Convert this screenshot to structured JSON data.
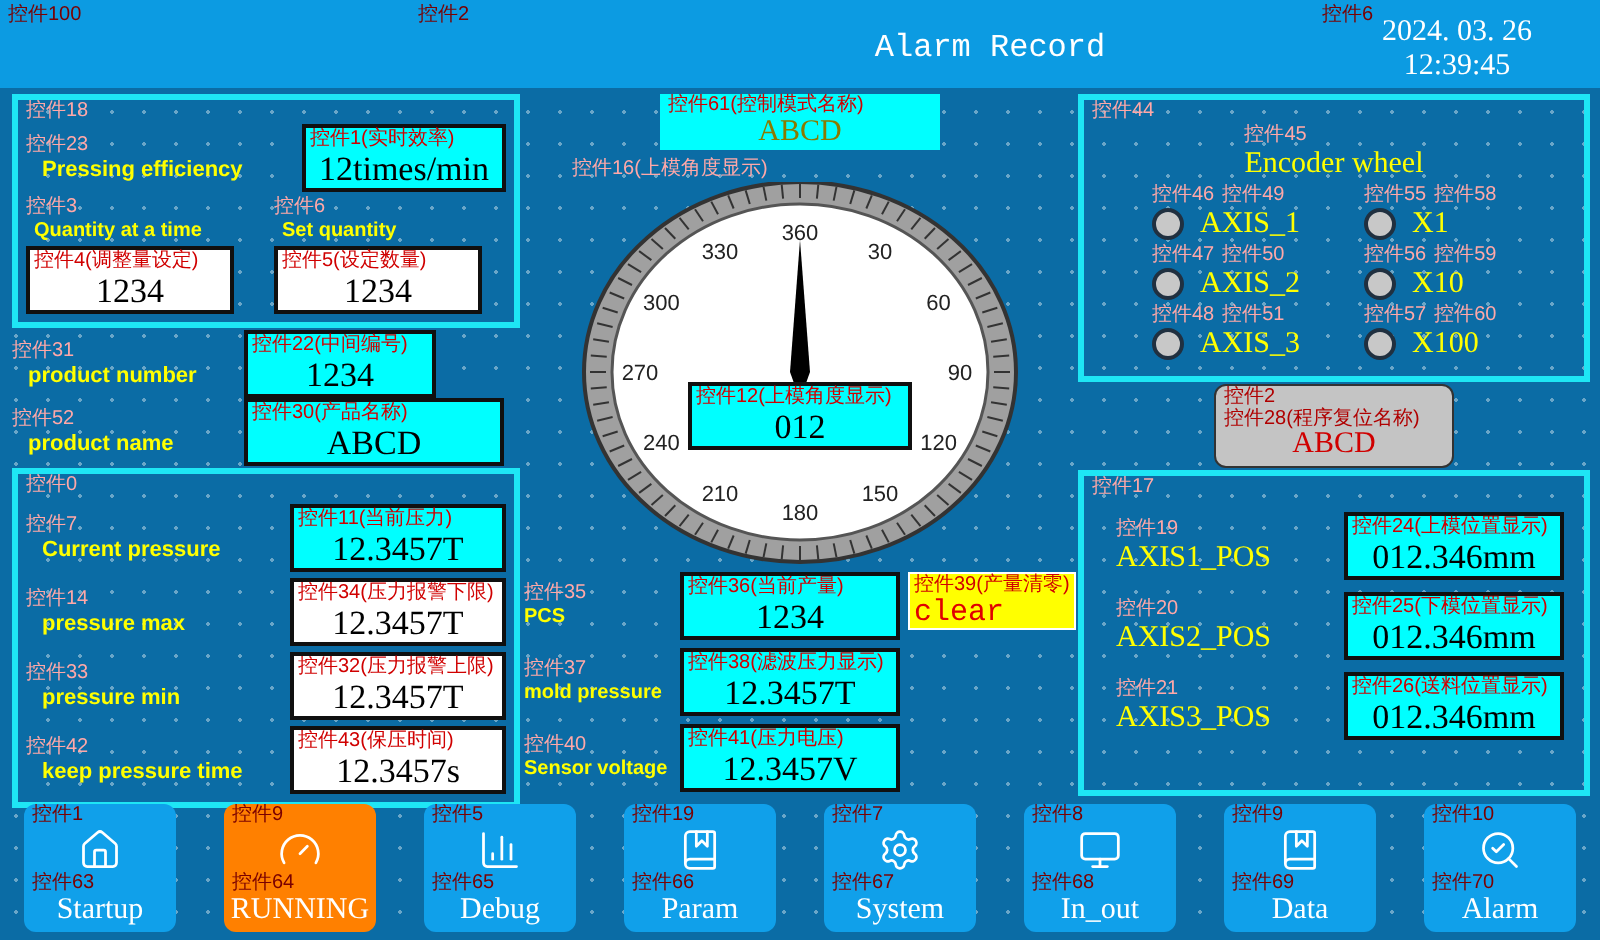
{
  "header": {
    "tag_left": "控件100",
    "tag_center": "控件2",
    "tag_right": "控件6",
    "title": "Alarm Record",
    "date": "2024. 03. 26",
    "time": "12:39:45"
  },
  "production_panel": {
    "tag": "控件18",
    "efficiency": {
      "label_tag": "控件23",
      "label": "Pressing efficiency",
      "field": {
        "tag": "控件1(实时效率)",
        "value": "12times/min",
        "kind": "display"
      }
    },
    "quantities": [
      {
        "label_tag": "控件3",
        "label": "Quantity at a time",
        "field": {
          "tag": "控件4(调整量设定)",
          "value": "1234",
          "kind": "input"
        }
      },
      {
        "label_tag": "控件6",
        "label": "Set quantity",
        "field": {
          "tag": "控件5(设定数量)",
          "value": "1234",
          "kind": "input"
        }
      }
    ]
  },
  "product_fields": [
    {
      "label_tag": "控件31",
      "label": "product number",
      "field": {
        "tag": "控件22(中间编号)",
        "value": "1234",
        "kind": "display"
      }
    },
    {
      "label_tag": "控件52",
      "label": "product name",
      "field": {
        "tag": "控件30(产品名称)",
        "value": "ABCD",
        "kind": "display"
      }
    }
  ],
  "pressure_panel": {
    "tag": "控件0",
    "rows": [
      {
        "label_tag": "控件7",
        "label": "Current pressure",
        "field": {
          "tag": "控件11(当前压力)",
          "value": "12.3457T",
          "kind": "display"
        }
      },
      {
        "label_tag": "控件14",
        "label": "pressure max",
        "field": {
          "tag": "控件34(压力报警下限)",
          "value": "12.3457T",
          "kind": "input"
        }
      },
      {
        "label_tag": "控件33",
        "label": "pressure min",
        "field": {
          "tag": "控件32(压力报警上限)",
          "value": "12.3457T",
          "kind": "input"
        }
      },
      {
        "label_tag": "控件42",
        "label": "keep pressure time",
        "field": {
          "tag": "控件43(保压时间)",
          "value": "12.3457s",
          "kind": "input"
        }
      }
    ]
  },
  "mode_display": {
    "tag": "控件61(控制模式名称)",
    "value": "ABCD"
  },
  "gauge": {
    "tag": "控件16(上模角度显示)",
    "scale": [
      "360",
      "30",
      "60",
      "90",
      "120",
      "150",
      "180",
      "210",
      "240",
      "270",
      "300",
      "330"
    ],
    "field": {
      "tag": "控件12(上模角度显示)",
      "value": "012",
      "kind": "display"
    }
  },
  "counters": [
    {
      "label_tag": "控件35",
      "label": "PCS",
      "field": {
        "tag": "控件36(当前产量)",
        "value": "1234",
        "kind": "display"
      },
      "action": {
        "tag": "控件39(产量清零)",
        "label": "clear"
      }
    },
    {
      "label_tag": "控件37",
      "label": "mold pressure",
      "field": {
        "tag": "控件38(滤波压力显示)",
        "value": "12.3457T",
        "kind": "display"
      }
    },
    {
      "label_tag": "控件40",
      "label": "Sensor voltage",
      "field": {
        "tag": "控件41(压力电压)",
        "value": "12.3457V",
        "kind": "display"
      }
    }
  ],
  "encoder_panel": {
    "tag": "控件44",
    "title_tag": "控件45",
    "title": "Encoder wheel",
    "options": [
      {
        "lamp_tag": "控件46",
        "label_tag": "控件49",
        "label": "AXIS_1",
        "on": false
      },
      {
        "lamp_tag": "控件55",
        "label_tag": "控件58",
        "label": "X1",
        "on": false
      },
      {
        "lamp_tag": "控件47",
        "label_tag": "控件50",
        "label": "AXIS_2",
        "on": false
      },
      {
        "lamp_tag": "控件56",
        "label_tag": "控件59",
        "label": "X10",
        "on": false
      },
      {
        "lamp_tag": "控件48",
        "label_tag": "控件51",
        "label": "AXIS_3",
        "on": false
      },
      {
        "lamp_tag": "控件57",
        "label_tag": "控件60",
        "label": "X100",
        "on": false
      }
    ]
  },
  "reset_button": {
    "tag": "控件2",
    "label_tag": "控件28(程序复位名称)",
    "label": "ABCD"
  },
  "position_panel": {
    "tag": "控件17",
    "rows": [
      {
        "label_tag": "控件19",
        "label": "AXIS1_POS",
        "field": {
          "tag": "控件24(上模位置显示)",
          "value": "012.346mm",
          "kind": "display"
        }
      },
      {
        "label_tag": "控件20",
        "label": "AXIS2_POS",
        "field": {
          "tag": "控件25(下模位置显示)",
          "value": "012.346mm",
          "kind": "display"
        }
      },
      {
        "label_tag": "控件21",
        "label": "AXIS3_POS",
        "field": {
          "tag": "控件26(送料位置显示)",
          "value": "012.346mm",
          "kind": "display"
        }
      }
    ]
  },
  "nav": [
    {
      "tag": "控件1",
      "label_tag": "控件63",
      "label": "Startup",
      "selected": false
    },
    {
      "tag": "控件9",
      "label_tag": "控件64",
      "label": "RUNNING",
      "selected": true
    },
    {
      "tag": "控件5",
      "label_tag": "控件65",
      "label": "Debug",
      "selected": false
    },
    {
      "tag": "控件19",
      "label_tag": "控件66",
      "label": "Param",
      "selected": false
    },
    {
      "tag": "控件7",
      "label_tag": "控件67",
      "label": "System",
      "selected": false
    },
    {
      "tag": "控件8",
      "label_tag": "控件68",
      "label": "In_out",
      "selected": false
    },
    {
      "tag": "控件9",
      "label_tag": "控件69",
      "label": "Data",
      "selected": false
    },
    {
      "tag": "控件10",
      "label_tag": "控件70",
      "label": "Alarm",
      "selected": false
    }
  ]
}
